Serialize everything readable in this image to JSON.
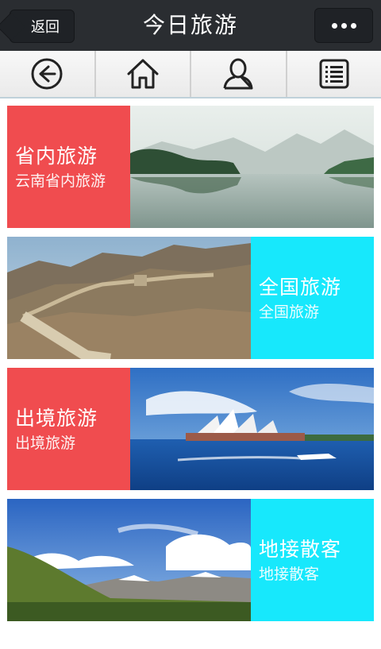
{
  "header": {
    "back_label": "返回",
    "title": "今日旅游"
  },
  "nav": [
    {
      "icon": "back-arrow-icon"
    },
    {
      "icon": "home-icon"
    },
    {
      "icon": "user-icon"
    },
    {
      "icon": "list-icon"
    }
  ],
  "cards": [
    {
      "main": "省内旅游",
      "sub": "云南省内旅游",
      "color": "#f04c4f",
      "image": "misty-lake-landscape"
    },
    {
      "main": "全国旅游",
      "sub": "全国旅游",
      "color": "#17e8fc",
      "image": "great-wall"
    },
    {
      "main": "出境旅游",
      "sub": "出境旅游",
      "color": "#f04c4f",
      "image": "sydney-opera-house"
    },
    {
      "main": "地接散客",
      "sub": "地接散客",
      "color": "#17e8fc",
      "image": "plateau-mountains"
    }
  ]
}
